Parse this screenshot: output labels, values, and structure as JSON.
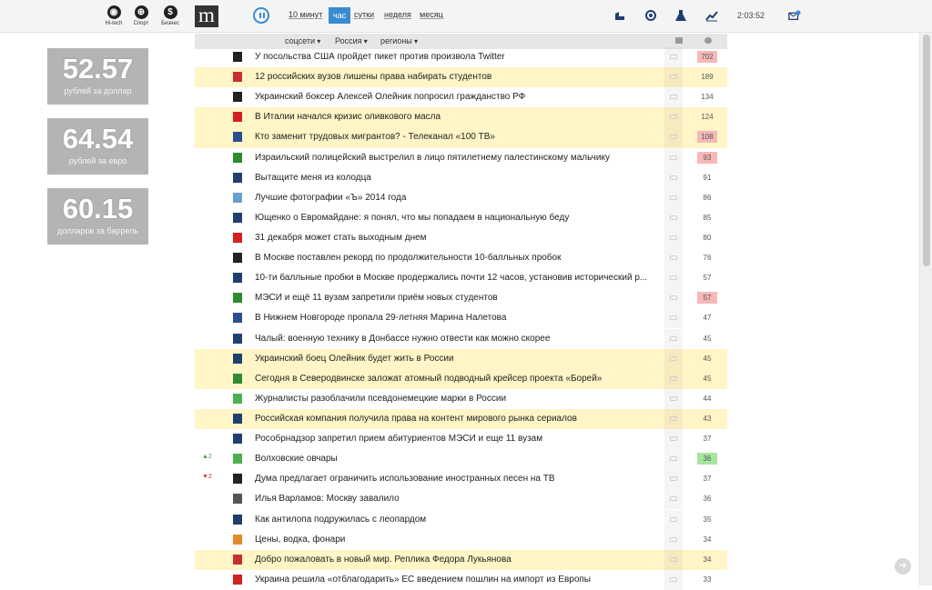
{
  "header": {
    "categories": [
      {
        "icon": "hitech-icon",
        "label": "Hi-tech"
      },
      {
        "icon": "sport-icon",
        "label": "Спорт"
      },
      {
        "icon": "business-icon",
        "label": "Бизнес"
      }
    ],
    "logo": "m",
    "periods": [
      "10 минут",
      "час",
      "сутки",
      "неделя",
      "месяц"
    ],
    "active_period": "час",
    "clock": "2:03:52",
    "right_icons": [
      "auto-icon",
      "tech-icon",
      "science-icon",
      "economy-chart-icon",
      "mail-icon"
    ]
  },
  "rates": [
    {
      "value": "52.57",
      "caption": "рублей за доллар"
    },
    {
      "value": "64.54",
      "caption": "рублей за евро"
    },
    {
      "value": "60.15",
      "caption": "долларов за баррель"
    }
  ],
  "filters": [
    "соцсети",
    "Россия",
    "регионы"
  ],
  "news": [
    {
      "title": "У посольства США пройдет пикет против произвола Twitter",
      "count": "702",
      "hl": false,
      "badge": "red",
      "src": "#222",
      "trend": ""
    },
    {
      "title": "12 российских вузов лишены права набирать студентов",
      "count": "189",
      "hl": true,
      "badge": "",
      "src": "#c83030",
      "trend": ""
    },
    {
      "title": "Украинский боксер Алексей Олейник попросил гражданство РФ",
      "count": "134",
      "hl": false,
      "badge": "",
      "src": "#222",
      "trend": ""
    },
    {
      "title": "В Италии начался кризис оливкового масла",
      "count": "124",
      "hl": true,
      "badge": "",
      "src": "#d32020",
      "trend": ""
    },
    {
      "title": "Кто заменит трудовых мигрантов? - Телеканал «100 ТВ»",
      "count": "108",
      "hl": true,
      "badge": "red",
      "src": "#2c4e8c",
      "trend": ""
    },
    {
      "title": "Израильский полицейский выстрелил в лицо пятилетнему палестинскому мальчику",
      "count": "93",
      "hl": false,
      "badge": "red",
      "src": "#2e8b2e",
      "trend": ""
    },
    {
      "title": "Вытащите меня из колодца",
      "count": "91",
      "hl": false,
      "badge": "",
      "src": "#1f3f6f",
      "trend": ""
    },
    {
      "title": "Лучшие фотографии «Ъ» 2014 года",
      "count": "86",
      "hl": false,
      "badge": "",
      "src": "#6aa0cc",
      "trend": ""
    },
    {
      "title": "Ющенко о Евромайдане: я понял, что мы попадаем в национальную беду",
      "count": "85",
      "hl": false,
      "badge": "",
      "src": "#1f3f6f",
      "trend": ""
    },
    {
      "title": "31 декабря может стать выходным днем",
      "count": "80",
      "hl": false,
      "badge": "",
      "src": "#d32020",
      "trend": ""
    },
    {
      "title": "В Москве поставлен рекорд по продолжительности 10-балльных пробок",
      "count": "76",
      "hl": false,
      "badge": "",
      "src": "#222",
      "trend": ""
    },
    {
      "title": "10-ти балльные пробки в Москве продержались почти 12 часов, установив исторический р...",
      "count": "57",
      "hl": false,
      "badge": "",
      "src": "#1f3f6f",
      "trend": ""
    },
    {
      "title": "МЭСИ и ещё 11 вузам запретили приём новых студентов",
      "count": "57",
      "hl": false,
      "badge": "red",
      "src": "#2e8b2e",
      "trend": ""
    },
    {
      "title": "В Нижнем Новгороде пропала 29-летняя Марина Налетова",
      "count": "47",
      "hl": false,
      "badge": "",
      "src": "#2c4e8c",
      "trend": ""
    },
    {
      "title": "Чалый: военную технику в Донбассе нужно отвести как можно скорее",
      "count": "45",
      "hl": false,
      "badge": "",
      "src": "#1f3f6f",
      "trend": ""
    },
    {
      "title": "Украинский боец Олейник будет жить в России",
      "count": "45",
      "hl": true,
      "badge": "",
      "src": "#1f3f6f",
      "trend": ""
    },
    {
      "title": "Сегодня в Северодвинске заложат атомный подводный крейсер проекта «Борей»",
      "count": "45",
      "hl": true,
      "badge": "",
      "src": "#2e8b2e",
      "trend": ""
    },
    {
      "title": "Журналисты разоблачили псевдонемецкие марки в России",
      "count": "44",
      "hl": false,
      "badge": "",
      "src": "#4caf50",
      "trend": ""
    },
    {
      "title": "Российская компания получила права на контент мирового рынка сериалов",
      "count": "43",
      "hl": true,
      "badge": "",
      "src": "#1f3f6f",
      "trend": ""
    },
    {
      "title": "Рособрнадзор запретил прием абитуриентов МЭСИ и еще 11 вузам",
      "count": "37",
      "hl": false,
      "badge": "",
      "src": "#1f3f6f",
      "trend": ""
    },
    {
      "title": "Волховские овчары",
      "count": "36",
      "hl": false,
      "badge": "green",
      "src": "#4caf50",
      "trend": "up",
      "trend_label": "▲2"
    },
    {
      "title": "Дума предлагает ограничить использование иностранных песен на ТВ",
      "count": "37",
      "hl": false,
      "badge": "",
      "src": "#222",
      "trend": "down",
      "trend_label": "▼2"
    },
    {
      "title": "Илья Варламов: Москву завалило",
      "count": "36",
      "hl": false,
      "badge": "",
      "src": "#555",
      "trend": ""
    },
    {
      "title": "Как антилопа подружилась с леопардом",
      "count": "35",
      "hl": false,
      "badge": "",
      "src": "#1f3f6f",
      "trend": ""
    },
    {
      "title": "Цены, водка, фонари",
      "count": "34",
      "hl": false,
      "badge": "",
      "src": "#e08a2c",
      "trend": ""
    },
    {
      "title": "Добро пожаловать в новый мир. Реплика Федора Лукьянова",
      "count": "34",
      "hl": true,
      "badge": "",
      "src": "#c83030",
      "trend": ""
    },
    {
      "title": "Украина решила «отблагодарить» ЕС введением пошлин на импорт из Европы",
      "count": "33",
      "hl": false,
      "badge": "",
      "src": "#d32020",
      "trend": ""
    }
  ]
}
